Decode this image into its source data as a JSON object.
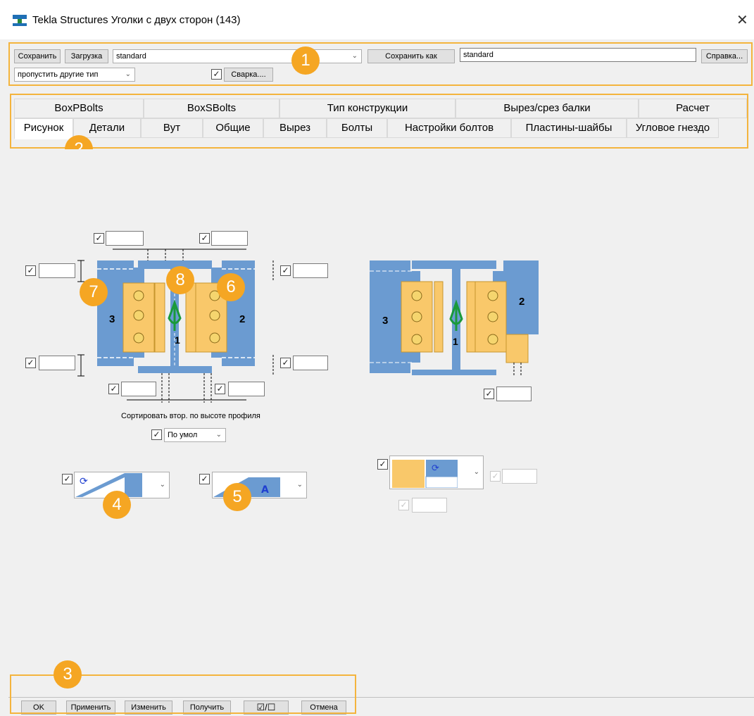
{
  "window": {
    "title": "Tekla Structures  Уголки с двух сторон (143)",
    "close_glyph": "✕"
  },
  "toolbar": {
    "save_label": "Сохранить",
    "load_label": "Загрузка",
    "load_value": "standard",
    "save_as_label": "Сохранить как",
    "save_as_value": "standard",
    "help_label": "Справка...",
    "filter_value": "пропустить другие тип",
    "weld_label": "Сварка....",
    "weld_checked": true
  },
  "tabs_top": [
    "BoxPBolts",
    "BoxSBolts",
    "Тип конструкции",
    "Вырез/срез балки",
    "Расчет"
  ],
  "tabs_bottom": [
    "Рисунок",
    "Детали",
    "Вут",
    "Общие",
    "Вырез",
    "Болты",
    "Настройки болтов",
    "Пластины-шайбы",
    "Угловое гнездо"
  ],
  "active_tab": "Рисунок",
  "picture": {
    "sort_label": "Сортировать втор. по высоте профиля",
    "sort_value": "По умол",
    "left_diagram": {
      "label_left": "3",
      "label_right": "2",
      "label_center": "1"
    },
    "right_diagram": {
      "label_left": "3",
      "label_right": "2",
      "label_center": "1"
    }
  },
  "badges": [
    "1",
    "2",
    "3",
    "4",
    "5",
    "6",
    "7",
    "8"
  ],
  "footer": {
    "ok_label": "OK",
    "apply_label": "Применить",
    "modify_label": "Изменить",
    "get_label": "Получить",
    "toggle_label": "☑/☐",
    "cancel_label": "Отмена"
  },
  "colors": {
    "accent_orange": "#f5a623",
    "frame_orange": "#f4b43d",
    "beam_blue": "#6b9bd1",
    "plate_yellow": "#f9c86a",
    "bolt_green": "#1a9a3a"
  },
  "icons": [
    "tekla-app-icon",
    "close-icon",
    "checkbox-icon",
    "chevron-down-icon",
    "rotate-icon",
    "weld-symbol-icon"
  ]
}
